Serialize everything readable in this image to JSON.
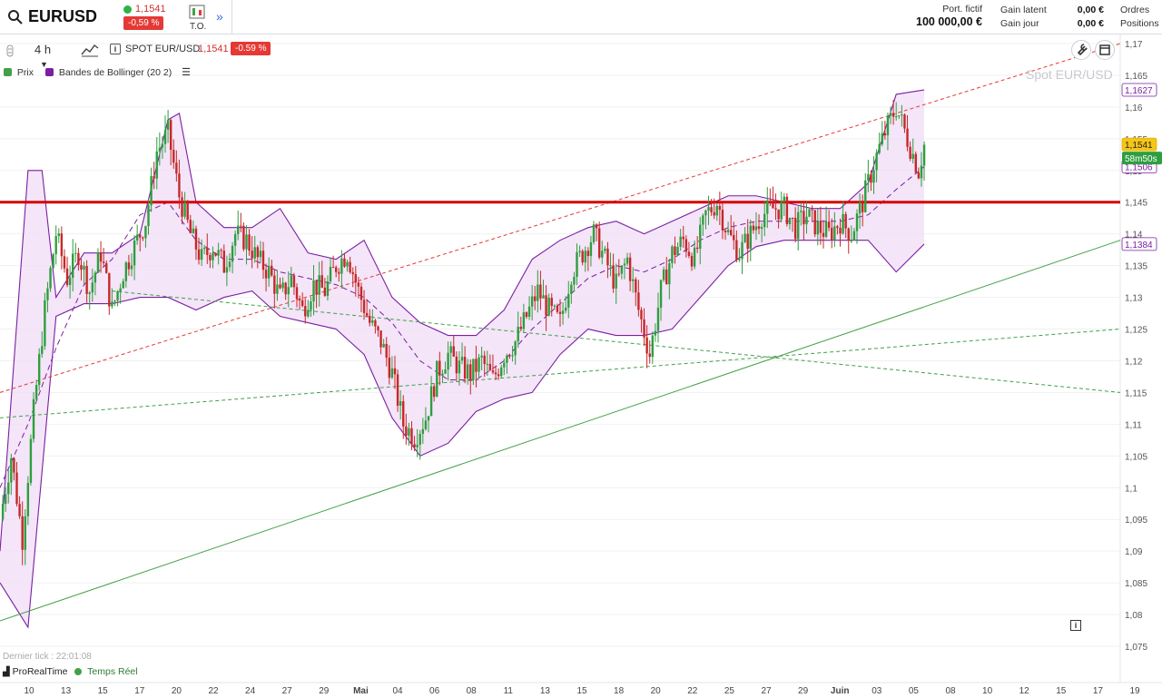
{
  "header": {
    "symbol": "EURUSD",
    "price": "1,1541",
    "change": "-0,59 %",
    "to_label": "T.O.",
    "port_label": "Port. fictif",
    "port_value": "100 000,00 €",
    "gain_latent_label": "Gain latent",
    "gain_jour_label": "Gain jour",
    "gain_latent_value": "0,00 €",
    "gain_jour_value": "0,00 €",
    "ordres_label": "Ordres",
    "positions_label": "Positions"
  },
  "toolbar": {
    "timeframe": "4 h",
    "instrument": "SPOT EUR/USD",
    "price": "1,1541",
    "change": "-0.59 %"
  },
  "legend": [
    {
      "label": "Prix",
      "color": "#43a047"
    },
    {
      "label": "Bandes de Bollinger (20 2)",
      "color": "#7b1fa2"
    }
  ],
  "watermark": "Spot EUR/USD",
  "footer": {
    "last_tick": "Dernier tick : 22:01:08",
    "source": "ProRealTime",
    "realtime": "Temps Réel"
  },
  "price_tags": {
    "upper_band": "1,1627",
    "last_price": "1,1541",
    "countdown": "58m50s",
    "middle_band": "1,1506",
    "lower_band": "1,1384"
  },
  "colors": {
    "up": "#2e9e3e",
    "down": "#c62828",
    "band_line": "#7b1fa2",
    "band_fill": "#f0dcf5",
    "support": "#d50000",
    "green_trend": "#43a047",
    "red_trend": "#e53935"
  },
  "chart_data": {
    "type": "candlestick",
    "title": "Spot EUR/USD",
    "timeframe": "4 h",
    "indicator": "Bollinger Bands (20, 2)",
    "ylim": [
      1.071,
      1.17
    ],
    "y_ticks": [
      "1,17",
      "1,165",
      "1,16",
      "1,155",
      "1,15",
      "1,145",
      "1,14",
      "1,135",
      "1,13",
      "1,125",
      "1,12",
      "1,115",
      "1,11",
      "1,105",
      "1,1",
      "1,095",
      "1,09",
      "1,085",
      "1,08",
      "1,075"
    ],
    "y_tick_values": [
      1.17,
      1.165,
      1.16,
      1.155,
      1.15,
      1.145,
      1.14,
      1.135,
      1.13,
      1.125,
      1.12,
      1.115,
      1.11,
      1.105,
      1.1,
      1.095,
      1.09,
      1.085,
      1.08,
      1.075
    ],
    "x_labels": [
      "10",
      "13",
      "15",
      "17",
      "20",
      "22",
      "24",
      "27",
      "29",
      "Mai",
      "04",
      "06",
      "08",
      "11",
      "13",
      "15",
      "18",
      "20",
      "22",
      "25",
      "27",
      "29",
      "Juin",
      "03",
      "05",
      "08",
      "10",
      "12",
      "15",
      "17",
      "19"
    ],
    "x_label_month": [
      "Mai",
      "Juin"
    ],
    "close_path": [
      [
        0,
        1.095
      ],
      [
        4,
        1.105
      ],
      [
        8,
        1.092
      ],
      [
        12,
        1.112
      ],
      [
        16,
        1.128
      ],
      [
        20,
        1.14
      ],
      [
        24,
        1.133
      ],
      [
        28,
        1.137
      ],
      [
        32,
        1.131
      ],
      [
        36,
        1.137
      ],
      [
        40,
        1.128
      ],
      [
        44,
        1.134
      ],
      [
        48,
        1.138
      ],
      [
        52,
        1.142
      ],
      [
        56,
        1.153
      ],
      [
        60,
        1.156
      ],
      [
        64,
        1.146
      ],
      [
        68,
        1.14
      ],
      [
        72,
        1.136
      ],
      [
        76,
        1.138
      ],
      [
        80,
        1.135
      ],
      [
        84,
        1.14
      ],
      [
        88,
        1.139
      ],
      [
        92,
        1.136
      ],
      [
        96,
        1.134
      ],
      [
        100,
        1.13
      ],
      [
        104,
        1.133
      ],
      [
        108,
        1.128
      ],
      [
        112,
        1.132
      ],
      [
        116,
        1.131
      ],
      [
        120,
        1.135
      ],
      [
        124,
        1.137
      ],
      [
        128,
        1.131
      ],
      [
        132,
        1.126
      ],
      [
        136,
        1.123
      ],
      [
        140,
        1.118
      ],
      [
        144,
        1.11
      ],
      [
        148,
        1.108
      ],
      [
        152,
        1.111
      ],
      [
        156,
        1.118
      ],
      [
        160,
        1.121
      ],
      [
        164,
        1.119
      ],
      [
        168,
        1.118
      ],
      [
        172,
        1.12
      ],
      [
        176,
        1.117
      ],
      [
        180,
        1.121
      ],
      [
        184,
        1.123
      ],
      [
        188,
        1.127
      ],
      [
        192,
        1.131
      ],
      [
        196,
        1.128
      ],
      [
        200,
        1.126
      ],
      [
        204,
        1.134
      ],
      [
        208,
        1.137
      ],
      [
        212,
        1.14
      ],
      [
        216,
        1.136
      ],
      [
        220,
        1.132
      ],
      [
        224,
        1.136
      ],
      [
        228,
        1.128
      ],
      [
        232,
        1.121
      ],
      [
        236,
        1.131
      ],
      [
        240,
        1.137
      ],
      [
        244,
        1.139
      ],
      [
        248,
        1.136
      ],
      [
        252,
        1.143
      ],
      [
        256,
        1.145
      ],
      [
        260,
        1.14
      ],
      [
        264,
        1.137
      ],
      [
        268,
        1.14
      ],
      [
        272,
        1.143
      ],
      [
        276,
        1.144
      ],
      [
        280,
        1.144
      ],
      [
        284,
        1.141
      ],
      [
        288,
        1.143
      ],
      [
        292,
        1.141
      ],
      [
        296,
        1.14
      ],
      [
        300,
        1.142
      ],
      [
        304,
        1.14
      ],
      [
        308,
        1.145
      ],
      [
        312,
        1.151
      ],
      [
        316,
        1.156
      ],
      [
        320,
        1.16
      ],
      [
        324,
        1.155
      ],
      [
        328,
        1.15
      ],
      [
        330,
        1.154
      ]
    ],
    "x_domain": [
      0,
      400
    ],
    "bollinger": {
      "upper": [
        [
          0,
          1.09
        ],
        [
          10,
          1.15
        ],
        [
          15,
          1.15
        ],
        [
          20,
          1.13
        ],
        [
          30,
          1.137
        ],
        [
          40,
          1.137
        ],
        [
          50,
          1.14
        ],
        [
          60,
          1.158
        ],
        [
          64,
          1.159
        ],
        [
          70,
          1.145
        ],
        [
          80,
          1.141
        ],
        [
          90,
          1.141
        ],
        [
          100,
          1.144
        ],
        [
          110,
          1.137
        ],
        [
          120,
          1.136
        ],
        [
          130,
          1.139
        ],
        [
          140,
          1.13
        ],
        [
          150,
          1.126
        ],
        [
          160,
          1.124
        ],
        [
          170,
          1.124
        ],
        [
          180,
          1.128
        ],
        [
          190,
          1.136
        ],
        [
          200,
          1.139
        ],
        [
          210,
          1.141
        ],
        [
          220,
          1.142
        ],
        [
          230,
          1.14
        ],
        [
          240,
          1.142
        ],
        [
          250,
          1.144
        ],
        [
          260,
          1.146
        ],
        [
          270,
          1.146
        ],
        [
          280,
          1.145
        ],
        [
          290,
          1.144
        ],
        [
          300,
          1.144
        ],
        [
          310,
          1.148
        ],
        [
          320,
          1.162
        ],
        [
          330,
          1.1627
        ]
      ],
      "middle": [
        [
          0,
          1.1
        ],
        [
          10,
          1.11
        ],
        [
          20,
          1.122
        ],
        [
          30,
          1.132
        ],
        [
          40,
          1.136
        ],
        [
          50,
          1.143
        ],
        [
          60,
          1.145
        ],
        [
          70,
          1.139
        ],
        [
          80,
          1.136
        ],
        [
          90,
          1.136
        ],
        [
          100,
          1.134
        ],
        [
          110,
          1.133
        ],
        [
          120,
          1.132
        ],
        [
          130,
          1.13
        ],
        [
          140,
          1.126
        ],
        [
          150,
          1.12
        ],
        [
          160,
          1.117
        ],
        [
          170,
          1.117
        ],
        [
          180,
          1.12
        ],
        [
          190,
          1.125
        ],
        [
          200,
          1.129
        ],
        [
          210,
          1.133
        ],
        [
          220,
          1.135
        ],
        [
          230,
          1.134
        ],
        [
          240,
          1.136
        ],
        [
          250,
          1.139
        ],
        [
          260,
          1.141
        ],
        [
          270,
          1.142
        ],
        [
          280,
          1.142
        ],
        [
          290,
          1.142
        ],
        [
          300,
          1.142
        ],
        [
          310,
          1.143
        ],
        [
          320,
          1.147
        ],
        [
          330,
          1.1506
        ]
      ],
      "lower": [
        [
          0,
          1.085
        ],
        [
          10,
          1.078
        ],
        [
          20,
          1.127
        ],
        [
          30,
          1.129
        ],
        [
          40,
          1.129
        ],
        [
          50,
          1.13
        ],
        [
          60,
          1.13
        ],
        [
          70,
          1.128
        ],
        [
          80,
          1.13
        ],
        [
          90,
          1.131
        ],
        [
          100,
          1.127
        ],
        [
          110,
          1.126
        ],
        [
          120,
          1.125
        ],
        [
          130,
          1.121
        ],
        [
          140,
          1.111
        ],
        [
          150,
          1.105
        ],
        [
          160,
          1.107
        ],
        [
          170,
          1.112
        ],
        [
          180,
          1.114
        ],
        [
          190,
          1.115
        ],
        [
          200,
          1.121
        ],
        [
          210,
          1.125
        ],
        [
          220,
          1.124
        ],
        [
          230,
          1.124
        ],
        [
          240,
          1.125
        ],
        [
          250,
          1.13
        ],
        [
          260,
          1.135
        ],
        [
          270,
          1.138
        ],
        [
          280,
          1.139
        ],
        [
          290,
          1.139
        ],
        [
          300,
          1.139
        ],
        [
          310,
          1.139
        ],
        [
          320,
          1.134
        ],
        [
          330,
          1.1384
        ]
      ]
    },
    "support_level": 1.145,
    "trendlines": [
      {
        "name": "red-dashed",
        "from": [
          0,
          1.115
        ],
        "to": [
          400,
          1.17
        ]
      },
      {
        "name": "green-solid",
        "from": [
          0,
          1.079
        ],
        "to": [
          400,
          1.139
        ]
      },
      {
        "name": "green-dashed-1",
        "from": [
          0,
          1.111
        ],
        "to": [
          400,
          1.125
        ]
      },
      {
        "name": "green-dashed-2",
        "from": [
          40,
          1.131
        ],
        "to": [
          400,
          1.115
        ]
      }
    ]
  }
}
